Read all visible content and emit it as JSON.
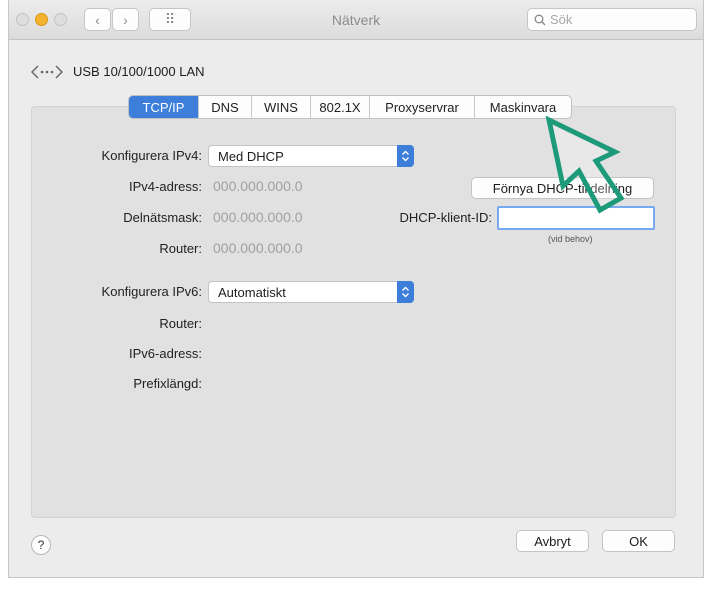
{
  "window": {
    "title": "Nätverk",
    "search_placeholder": "Sök"
  },
  "toolbar": {
    "back_glyph": "‹",
    "forward_glyph": "›",
    "grid_glyph": "⠿"
  },
  "interface": {
    "icon": "ethernet-icon",
    "name": "USB 10/100/1000 LAN"
  },
  "tabs": [
    "TCP/IP",
    "DNS",
    "WINS",
    "802.1X",
    "Proxyservrar",
    "Maskinvara"
  ],
  "active_tab": "TCP/IP",
  "ipv4": {
    "configure_label": "Konfigurera IPv4:",
    "configure_value": "Med DHCP",
    "address_label": "IPv4-adress:",
    "address_value": "000.000.000.0",
    "subnet_label": "Delnätsmask:",
    "subnet_value": "000.000.000.0",
    "router_label": "Router:",
    "router_value": "000.000.000.0",
    "renew_button": "Förnya DHCP-tilldelning",
    "client_id_label": "DHCP-klient-ID:",
    "client_id_value": "",
    "client_id_hint": "(vid behov)"
  },
  "ipv6": {
    "configure_label": "Konfigurera IPv6:",
    "configure_value": "Automatiskt",
    "router_label": "Router:",
    "address_label": "IPv6-adress:",
    "prefix_label": "Prefixlängd:"
  },
  "footer": {
    "help_label": "?",
    "cancel_button": "Avbryt",
    "ok_button": "OK"
  },
  "colors": {
    "accent": "#3c7ed9",
    "annotation_arrow": "#1d9a7a"
  }
}
